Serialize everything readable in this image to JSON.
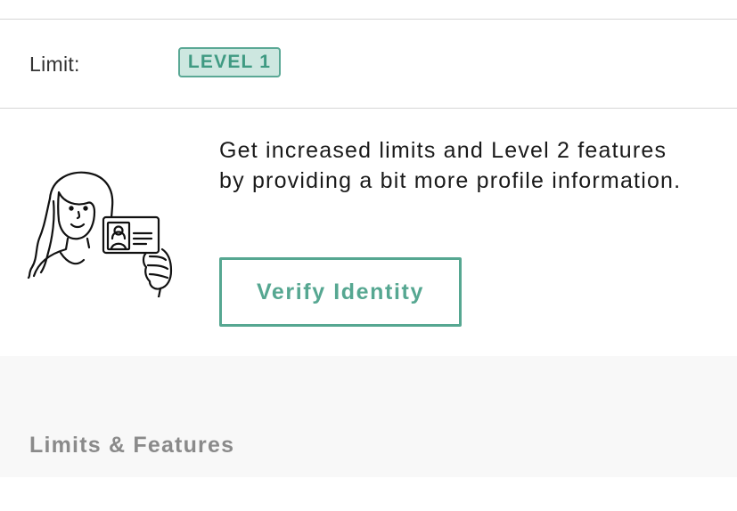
{
  "limit": {
    "label": "Limit:",
    "level_badge": "LEVEL 1"
  },
  "verification_promo": {
    "illustration_icon": "person-holding-id-card-icon",
    "message": "Get increased limits and Level 2 features by providing a bit more profile information.",
    "verify_button_label": "Verify Identity"
  },
  "features": {
    "section_title": "Limits & Features"
  },
  "colors": {
    "accent": "#56a791",
    "badge_background": "#cde7e0",
    "section_background": "#f8f8f8",
    "divider": "#d6d6d6"
  }
}
